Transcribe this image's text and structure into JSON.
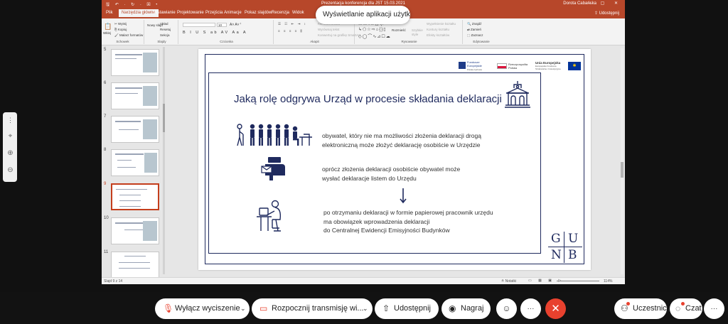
{
  "powerpoint": {
    "window_title": "Prezentacja konferencja dla JST 15.03.2021",
    "user_name": "Dorota Cabańska",
    "share_label": "Udostępnij",
    "quick_access": "🖫 ↶ · ↻ · ▣ ▾",
    "window_controls": "─ ▢ ✕",
    "tabs": [
      {
        "label": "Plik"
      },
      {
        "label": "Narzędzia główne"
      },
      {
        "label": "Wstawianie"
      },
      {
        "label": "Projektowanie"
      },
      {
        "label": "Przejścia"
      },
      {
        "label": "Animacje"
      },
      {
        "label": "Pokaz slajdów"
      },
      {
        "label": "Recenzja"
      },
      {
        "label": "Widok"
      }
    ],
    "ribbon": {
      "clipboard": {
        "paste": "Wklej",
        "cut": "Wytnij",
        "copy": "Kopiuj",
        "format_painter": "Malarz formatów",
        "group_label": "Schowek"
      },
      "slides": {
        "new_slide": "Nowy slajd",
        "layout": "Układ",
        "reset": "Resetuj",
        "section": "Sekcja",
        "group_label": "Slajdy"
      },
      "font": {
        "size": "10",
        "group_label": "Czcionka"
      },
      "paragraph": {
        "text_direction": "Kierunek tekstu",
        "align_text": "Wyrównaj tekst",
        "smartart": "Konwertuj na grafikę SmartArt",
        "group_label": "Akapit"
      },
      "drawing": {
        "arrange": "Rozmieść",
        "quick_styles": "Szybkie style",
        "shape_fill": "Wypełnienie kształtu",
        "shape_outline": "Kontury kształtu",
        "shape_effects": "Efekty kształtów",
        "group_label": "Rysowanie"
      },
      "editing": {
        "find": "Znajdź",
        "replace": "Zamień",
        "select": "Zaznacz",
        "group_label": "Edytowanie"
      }
    },
    "status": {
      "slide_counter": "Slajd 9 z 14",
      "notes": "Notatki",
      "zoom": "114%"
    }
  },
  "toast": {
    "text": "Wyświetlanie aplikacji użytko..."
  },
  "thumbnails": [
    {
      "num": "5"
    },
    {
      "num": "6"
    },
    {
      "num": "7"
    },
    {
      "num": "8"
    },
    {
      "num": "9"
    },
    {
      "num": "10"
    },
    {
      "num": "11"
    }
  ],
  "slide": {
    "title": "Jaką rolę odgrywa Urząd w procesie składania deklaracji",
    "p1": [
      "obywatel, który nie ma możliwości złożenia deklaracji drogą",
      "elektroniczną może złożyć deklarację osobiście w Urzędzie"
    ],
    "p2": [
      "oprócz złożenia deklaracji osobiście obywatel może",
      "wysłać deklaracje listem do Urzędu"
    ],
    "p3": [
      "po otrzymaniu deklaracji w formie papierowej pracownik urzędu",
      "ma obowiązek wprowadzenia deklaracji",
      "do Centralnej Ewidencji Emisyjności Budynków"
    ],
    "logos": {
      "eu_funds": "Fundusze Europejskie",
      "eu_funds_sub": "Polska Cyfrowa",
      "poland": "Rzeczpospolita Polska",
      "eu": "Unia Europejska",
      "eu_sub": "Europejskie Fundusze Strukturalne i Inwestycyjne"
    },
    "gunb": [
      "G",
      "U",
      "N",
      "B"
    ]
  },
  "meeting_bar": {
    "mute_label": "Wyłącz wyciszenie",
    "broadcast_label": "Rozpocznij transmisję wi...",
    "share_label": "Udostępnij",
    "record_label": "Nagraj",
    "participants_label": "Uczestnicy",
    "chat_label": "Czat",
    "more": "···",
    "end": "✕"
  },
  "colors": {
    "ppt_accent": "#b7472a",
    "slide_navy": "#1f2a5e",
    "end_call": "#e8412e"
  }
}
